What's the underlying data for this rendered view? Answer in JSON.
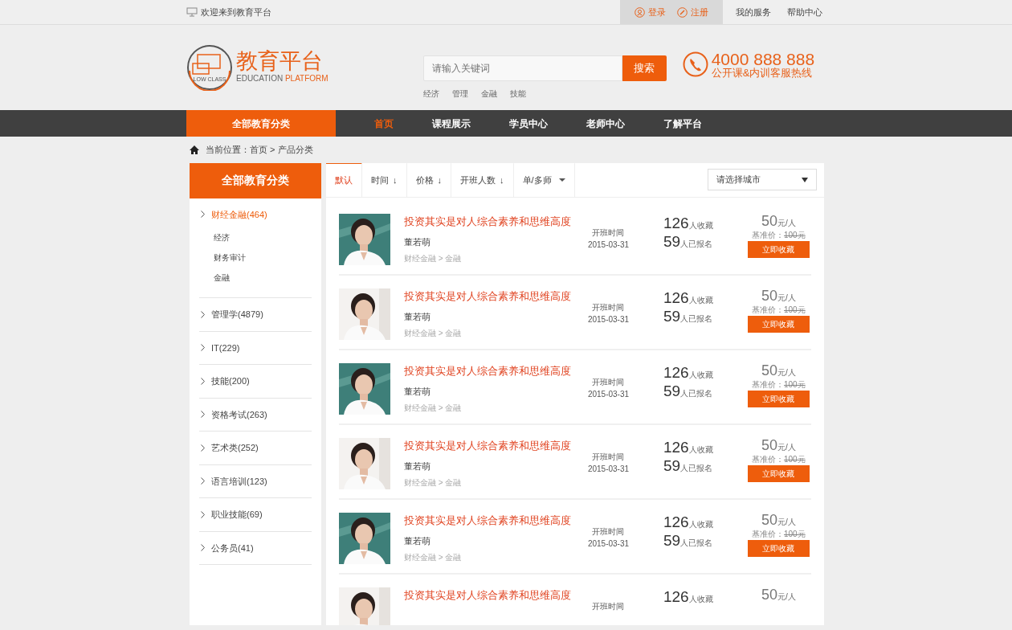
{
  "top_bar": {
    "welcome": "欢迎来到教育平台",
    "login": "登录",
    "register": "注册",
    "links": [
      "我的服务",
      "帮助中心"
    ]
  },
  "header": {
    "logo_title": "教育平台",
    "logo_ring": "LOW CLASS",
    "logo_sub": "EDUCATION",
    "logo_sub_accent": "PLATFORM",
    "search": {
      "placeholder": "请输入关键词",
      "button": "搜索"
    },
    "hot_words": [
      "经济",
      "管理",
      "金融",
      "技能"
    ],
    "hotline": {
      "number": "4000 888 888",
      "caption": "公开课&内训客服热线"
    }
  },
  "nav": {
    "category_label": "全部教育分类",
    "items": [
      {
        "label": "首页",
        "selected": true
      },
      {
        "label": "课程展示",
        "selected": false
      },
      {
        "label": "学员中心",
        "selected": false
      },
      {
        "label": "老师中心",
        "selected": false
      },
      {
        "label": "了解平台",
        "selected": false
      }
    ]
  },
  "breadcrumb": "当前位置：首页 > 产品分类",
  "sidebar": {
    "title": "全部教育分类",
    "categories": [
      {
        "label": "财经金融(464)",
        "expanded": true,
        "children": [
          {
            "label": "经济"
          },
          {
            "label": "财务审计"
          },
          {
            "label": "金融"
          }
        ]
      },
      {
        "label": "管理学(4879)",
        "expanded": false
      },
      {
        "label": "IT(229)",
        "expanded": false
      },
      {
        "label": "技能(200)",
        "expanded": false
      },
      {
        "label": "资格考试(263)",
        "expanded": false
      },
      {
        "label": "艺术类(252)",
        "expanded": false
      },
      {
        "label": "语言培训(123)",
        "expanded": false
      },
      {
        "label": "职业技能(69)",
        "expanded": false
      },
      {
        "label": "公务员(41)",
        "expanded": false
      }
    ]
  },
  "sort_tabs": [
    {
      "label": "默认",
      "kind": "plain",
      "selected": true
    },
    {
      "label": "时间",
      "kind": "arrow",
      "arrow": "↓",
      "selected": false
    },
    {
      "label": "价格",
      "kind": "arrow",
      "arrow": "↓",
      "selected": false
    },
    {
      "label": "开班人数",
      "kind": "arrow",
      "arrow": "↓",
      "selected": false
    },
    {
      "label": "单/多师",
      "kind": "dropdown",
      "selected": false
    }
  ],
  "city_select": {
    "placeholder": "请选择城市"
  },
  "courses": [
    {
      "title": "投资其实是对人综合素养和思维高度",
      "teacher": "董若萌",
      "category": "财经金融 > 金融",
      "date_label": "开班时间",
      "date": "2015-03-31",
      "favorites": "126",
      "favorites_label": "人收藏",
      "enrolled": "59",
      "enrolled_label": "人已报名",
      "price": "50",
      "price_unit": "元/人",
      "base_price_label": "基准价：",
      "base_price": "100元",
      "button": "立即收藏"
    },
    {
      "title": "投资其实是对人综合素养和思维高度",
      "teacher": "董若萌",
      "category": "财经金融 > 金融",
      "date_label": "开班时间",
      "date": "2015-03-31",
      "favorites": "126",
      "favorites_label": "人收藏",
      "enrolled": "59",
      "enrolled_label": "人已报名",
      "price": "50",
      "price_unit": "元/人",
      "base_price_label": "基准价：",
      "base_price": "100元",
      "button": "立即收藏"
    },
    {
      "title": "投资其实是对人综合素养和思维高度",
      "teacher": "董若萌",
      "category": "财经金融 > 金融",
      "date_label": "开班时间",
      "date": "2015-03-31",
      "favorites": "126",
      "favorites_label": "人收藏",
      "enrolled": "59",
      "enrolled_label": "人已报名",
      "price": "50",
      "price_unit": "元/人",
      "base_price_label": "基准价：",
      "base_price": "100元",
      "button": "立即收藏"
    },
    {
      "title": "投资其实是对人综合素养和思维高度",
      "teacher": "董若萌",
      "category": "财经金融 > 金融",
      "date_label": "开班时间",
      "date": "2015-03-31",
      "favorites": "126",
      "favorites_label": "人收藏",
      "enrolled": "59",
      "enrolled_label": "人已报名",
      "price": "50",
      "price_unit": "元/人",
      "base_price_label": "基准价：",
      "base_price": "100元",
      "button": "立即收藏"
    },
    {
      "title": "投资其实是对人综合素养和思维高度",
      "teacher": "董若萌",
      "category": "财经金融 > 金融",
      "date_label": "开班时间",
      "date": "2015-03-31",
      "favorites": "126",
      "favorites_label": "人收藏",
      "enrolled": "59",
      "enrolled_label": "人已报名",
      "price": "50",
      "price_unit": "元/人",
      "base_price_label": "基准价：",
      "base_price": "100元",
      "button": "立即收藏"
    },
    {
      "title": "投资其实是对人综合素养和思维高度",
      "date_label": "开班时间",
      "favorites": "126",
      "favorites_label": "人收藏",
      "price": "50",
      "price_unit": "元/人"
    }
  ]
}
